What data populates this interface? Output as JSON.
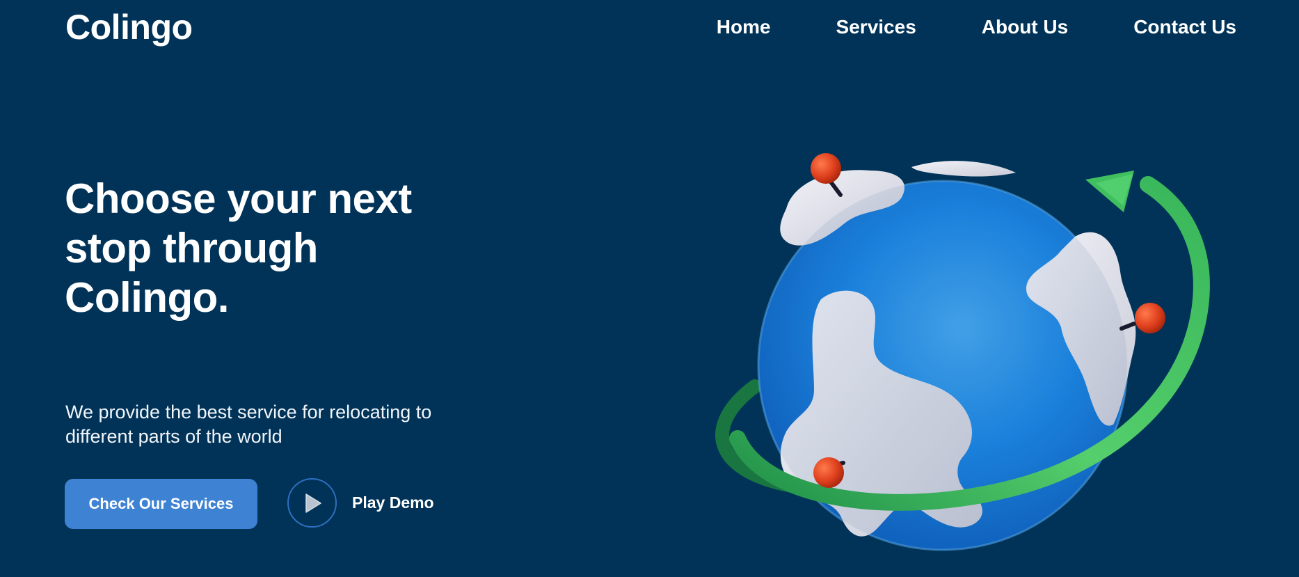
{
  "brand": {
    "logo_text": "Colingo"
  },
  "nav": {
    "items": [
      {
        "label": "Home"
      },
      {
        "label": "Services"
      },
      {
        "label": "About Us"
      },
      {
        "label": "Contact Us"
      }
    ]
  },
  "hero": {
    "title_line1": "Choose your next",
    "title_line2": "stop through",
    "title_line3": "Colingo.",
    "subtitle_line1": "We provide the best service for relocating to",
    "subtitle_line2": "different parts of the world",
    "cta_label": "Check Our Services",
    "play_label": "Play Demo"
  },
  "illustration": {
    "icon": "globe-with-location-pins-icon"
  },
  "colors": {
    "background": "#013358",
    "button_primary": "#3e82d4",
    "text": "#ffffff",
    "globe_blue": "#1e88e5",
    "orbit_green": "#3fc46a",
    "pin_red": "#e0411e"
  }
}
